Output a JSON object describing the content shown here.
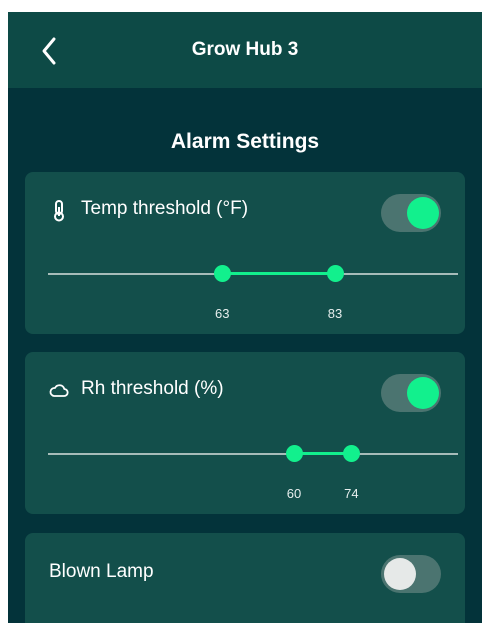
{
  "header": {
    "title": "Grow Hub 3",
    "back_icon": "chevron-left-icon"
  },
  "section_title": "Alarm Settings",
  "colors": {
    "background": "#03333a",
    "header": "#0d4a46",
    "card": "#134f4b",
    "accent": "#12f08d",
    "toggle_track": "#4b7470",
    "slider_track": "#a7bcb9"
  },
  "temp": {
    "icon": "thermometer-icon",
    "label": "Temp threshold (°F)",
    "enabled": true,
    "low": "63",
    "high": "83",
    "low_fraction": 0.425,
    "high_fraction": 0.7
  },
  "rh": {
    "icon": "cloud-icon",
    "label": "Rh threshold (%)",
    "enabled": true,
    "low": "60",
    "high": "74",
    "low_fraction": 0.6,
    "high_fraction": 0.74
  },
  "lamp": {
    "label": "Blown Lamp",
    "enabled": false
  }
}
